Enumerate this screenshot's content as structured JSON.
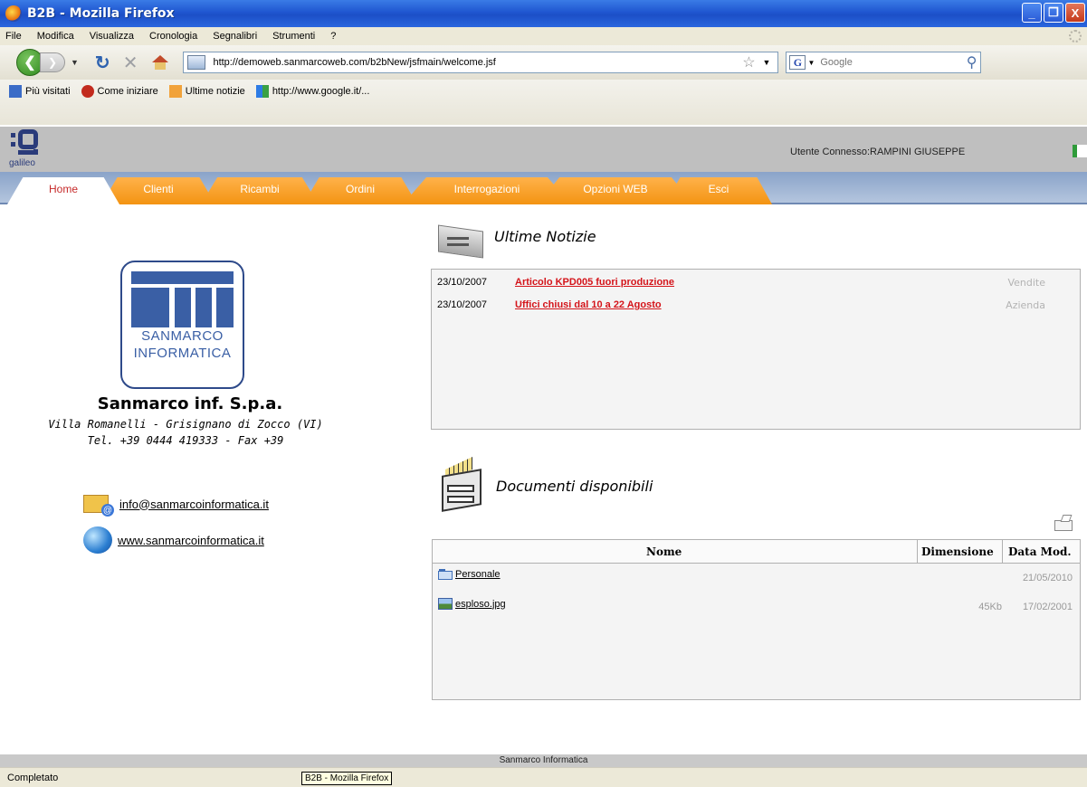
{
  "window": {
    "title": "B2B - Mozilla Firefox",
    "buttons": {
      "minimize": "_",
      "maximize": "❐",
      "close": "X"
    }
  },
  "menu": {
    "items": [
      "File",
      "Modifica",
      "Visualizza",
      "Cronologia",
      "Segnalibri",
      "Strumenti",
      "?"
    ]
  },
  "navigation": {
    "url": "http://demoweb.sanmarcoweb.com/b2bNew/jsfmain/welcome.jsf",
    "search_placeholder": "Google",
    "search_engine_letter": "G"
  },
  "bookmarks": [
    {
      "label": "Più visitati",
      "icon": "most-visited-icon"
    },
    {
      "label": "Come iniziare",
      "icon": "getting-started-icon"
    },
    {
      "label": "Ultime notizie",
      "icon": "rss-feed-icon"
    },
    {
      "label": "http://www.google.it/...",
      "icon": "google-icon"
    }
  ],
  "app_header": {
    "logo_text": "galileo",
    "user_label": "Utente Connesso:RAMPINI GIUSEPPE"
  },
  "tabs": [
    "Home",
    "Clienti",
    "Ricambi",
    "Ordini",
    "Interrogazioni",
    "Opzioni WEB",
    "Esci"
  ],
  "company": {
    "logo_line1": "SANMARCO",
    "logo_line2": "INFORMATICA",
    "name": "Sanmarco inf. S.p.a.",
    "address": "Villa Romanelli - Grisignano di Zocco (VI)",
    "phone": "Tel. +39 0444 419333 - Fax +39",
    "email": "info@sanmarcoinformatica.it",
    "website": "www.sanmarcoinformatica.it"
  },
  "news": {
    "title": "Ultime Notizie",
    "items": [
      {
        "date": "23/10/2007",
        "title": "Articolo KPD005 fuori produzione",
        "category": "Vendite"
      },
      {
        "date": "23/10/2007",
        "title": "Uffici chiusi dal 10 a 22 Agosto",
        "category": "Azienda"
      }
    ]
  },
  "documents": {
    "title": "Documenti disponibili",
    "columns": [
      "Nome",
      "Dimensione",
      "Data Mod."
    ],
    "rows": [
      {
        "name": "Personale",
        "type": "folder",
        "size": "",
        "date": "21/05/2010"
      },
      {
        "name": "esploso.jpg",
        "type": "image",
        "size": "45Kb",
        "date": "17/02/2001"
      }
    ]
  },
  "footer": {
    "text": "Sanmarco Informatica"
  },
  "statusbar": {
    "status": "Completato",
    "taskbar_tooltip": "B2B - Mozilla Firefox"
  },
  "colors": {
    "tab_orange": "#f39412",
    "tab_active_text": "#c62a2a",
    "news_link": "#d4141a",
    "brand_blue": "#3a5fa5"
  }
}
